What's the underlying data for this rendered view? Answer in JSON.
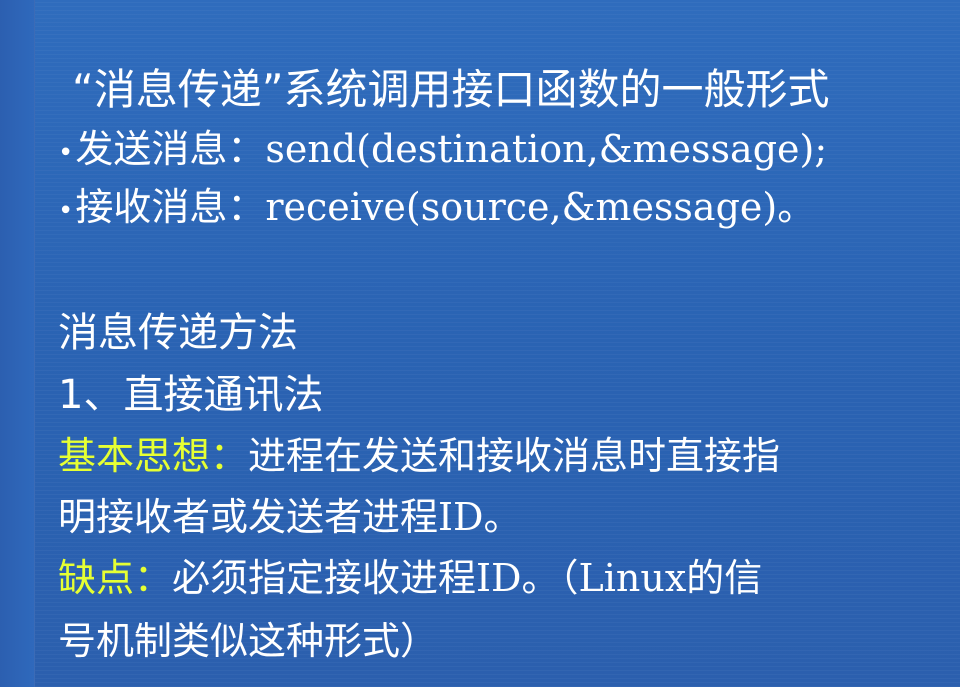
{
  "slide": {
    "title": "“消息传递”系统调用接口函数的一般形式",
    "bullets": [
      {
        "marker": "•",
        "label": "发送消息：",
        "code": "send(destination,&message);"
      },
      {
        "marker": "•",
        "label": "接收消息：",
        "code": "receive(source,&message)。"
      }
    ],
    "section_heading": "消息传递方法",
    "subheading": "1、直接通讯法",
    "basic_idea": {
      "label": "基本思想：",
      "text_line1": "进程在发送和接收消息时直接指",
      "text_line2": "明接收者或发送者进程ID。"
    },
    "drawback": {
      "label": "缺点：",
      "text_line1": "必须指定接收进程ID。（Linux的信",
      "text_line2": "号机制类似这种形式）"
    }
  },
  "colors": {
    "background": "#2a63b3",
    "text": "#ffffff",
    "highlight": "#e6ff33"
  }
}
